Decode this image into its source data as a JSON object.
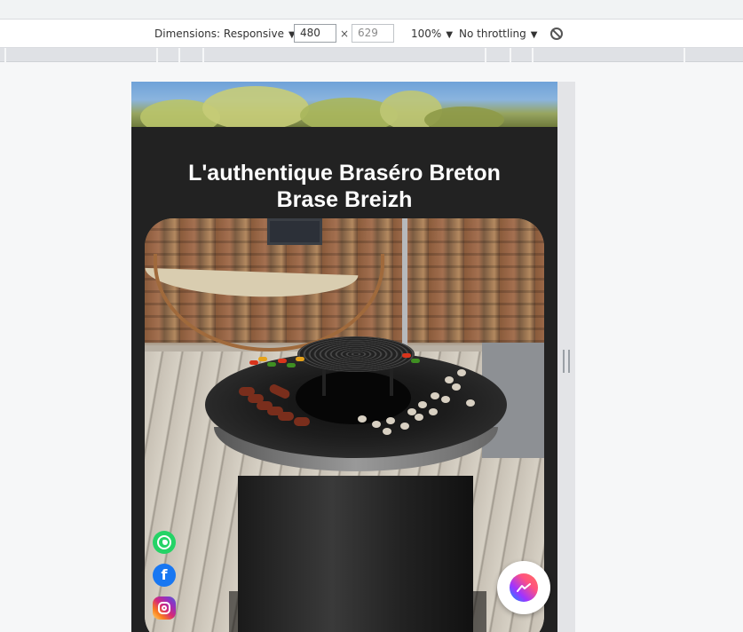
{
  "devtools": {
    "dimensions_label": "Dimensions: Responsive",
    "width_value": "480",
    "times_sign": "×",
    "height_placeholder": "629",
    "zoom_label": "100%",
    "throttling_label": "No throttling",
    "caret": "▼",
    "icons": {
      "rotate": "rotate-icon",
      "resize": "resize-handle"
    }
  },
  "page": {
    "title_line1": "L'authentique Braséro Breton",
    "title_line2": "Brase Breizh",
    "hero_image": "garden-foliage-sky",
    "main_image": "brasero-grill-on-wooden-deck"
  },
  "social": {
    "items": [
      {
        "name": "whatsapp",
        "icon": "whatsapp-icon",
        "color": "#25d366"
      },
      {
        "name": "facebook",
        "icon": "facebook-icon",
        "glyph": "f",
        "color": "#1877f2"
      },
      {
        "name": "instagram",
        "icon": "instagram-icon",
        "color": "#d62976"
      }
    ]
  },
  "messenger": {
    "icon": "messenger-icon"
  },
  "colors": {
    "page_background": "#222222",
    "title_text": "#ffffff",
    "devtools_bg": "#ffffff",
    "ruler_bg": "#dfe1e5"
  }
}
